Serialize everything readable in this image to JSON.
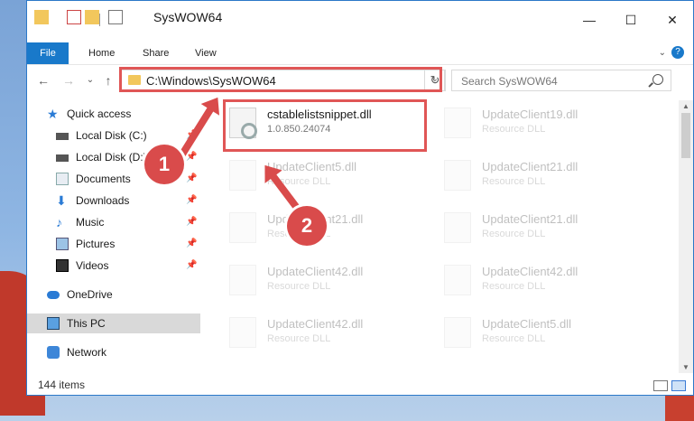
{
  "window": {
    "title": "SysWOW64"
  },
  "ribbon": {
    "tabs": [
      "File",
      "Home",
      "Share",
      "View"
    ]
  },
  "address": {
    "path": "C:\\Windows\\SysWOW64"
  },
  "search": {
    "placeholder": "Search SysWOW64"
  },
  "sidebar": {
    "items": [
      {
        "label": "Quick access"
      },
      {
        "label": "Local Disk (C:)"
      },
      {
        "label": "Local Disk (D:)"
      },
      {
        "label": "Documents"
      },
      {
        "label": "Downloads"
      },
      {
        "label": "Music"
      },
      {
        "label": "Pictures"
      },
      {
        "label": "Videos"
      },
      {
        "label": "OneDrive"
      },
      {
        "label": "This PC"
      },
      {
        "label": "Network"
      }
    ]
  },
  "files": [
    {
      "name": "cstablelistsnippet.dll",
      "sub": "1.0.850.24074"
    },
    {
      "name": "UpdateClient19.dll",
      "sub": "Resource DLL"
    },
    {
      "name": "UpdateClient5.dll",
      "sub": "Resource DLL"
    },
    {
      "name": "UpdateClient21.dll",
      "sub": "Resource DLL"
    },
    {
      "name": "UpdateClient21.dll",
      "sub": "Resource DLL"
    },
    {
      "name": "UpdateClient21.dll",
      "sub": "Resource DLL"
    },
    {
      "name": "UpdateClient42.dll",
      "sub": "Resource DLL"
    },
    {
      "name": "UpdateClient42.dll",
      "sub": "Resource DLL"
    },
    {
      "name": "UpdateClient42.dll",
      "sub": "Resource DLL"
    },
    {
      "name": "UpdateClient5.dll",
      "sub": "Resource DLL"
    }
  ],
  "status": {
    "item_count": "144 items"
  },
  "annotations": {
    "badge1": "1",
    "badge2": "2"
  },
  "colors": {
    "accent": "#1979ca",
    "highlight": "#e05656"
  }
}
